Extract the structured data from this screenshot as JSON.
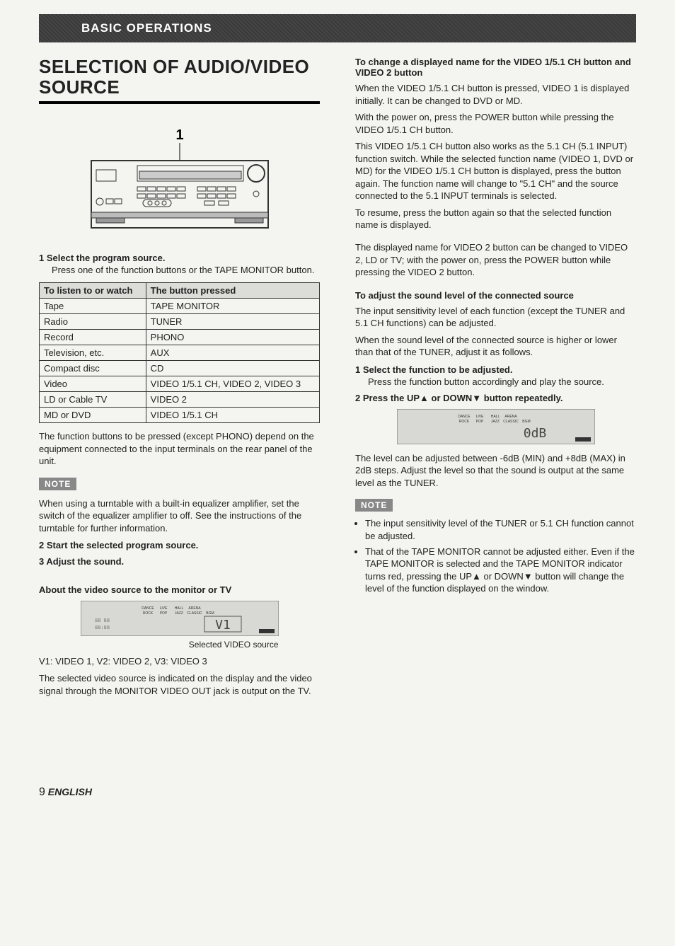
{
  "banner": "BASIC OPERATIONS",
  "title": "SELECTION OF AUDIO/VIDEO SOURCE",
  "diagram_label": "1",
  "left": {
    "step1_label": "1  Select the program source.",
    "step1_body": "Press one of the function buttons or the TAPE MONITOR button.",
    "table": {
      "headers": [
        "To listen to or watch",
        "The button pressed"
      ],
      "rows": [
        [
          "Tape",
          "TAPE MONITOR"
        ],
        [
          "Radio",
          "TUNER"
        ],
        [
          "Record",
          "PHONO"
        ],
        [
          "Television, etc.",
          "AUX"
        ],
        [
          "Compact disc",
          "CD"
        ],
        [
          "Video",
          "VIDEO 1/5.1 CH, VIDEO 2, VIDEO 3"
        ],
        [
          "LD or Cable TV",
          "VIDEO 2"
        ],
        [
          "MD or DVD",
          "VIDEO 1/5.1 CH"
        ]
      ]
    },
    "after_table": "The function buttons to be pressed (except PHONO) depend on the equipment connected to the input terminals on the rear panel of the unit.",
    "note_label": "NOTE",
    "note1_text": "When using a turntable with a built-in equalizer amplifier, set the switch of the equalizer amplifier to off. See the instructions of the turntable for further information.",
    "step2_label": "2  Start the selected program source.",
    "step3_label": "3  Adjust the sound.",
    "about_head": "About the video source to the monitor or TV",
    "display_labels": [
      "DANCE",
      "LIVE",
      "HALL",
      "ARENA",
      "",
      "ROCK",
      "POP",
      "JAZZ",
      "CLASSIC",
      "BGM"
    ],
    "display_value": "V1",
    "display_caption": "Selected VIDEO source",
    "video_legend": "V1: VIDEO 1, V2: VIDEO 2, V3: VIDEO 3",
    "video_para": "The selected video source is indicated on the display and the video signal through the MONITOR VIDEO OUT jack is output on the TV."
  },
  "right": {
    "head1": "To change a displayed name for the VIDEO 1/5.1 CH button and VIDEO 2 button",
    "p1": "When the VIDEO 1/5.1 CH button is pressed, VIDEO 1 is displayed initially. It can be changed to DVD or MD.",
    "p2": "With the power on, press the POWER button while pressing the VIDEO 1/5.1 CH button.",
    "p3": "This VIDEO 1/5.1 CH button also works as the 5.1 CH (5.1 INPUT) function switch. While the selected function name (VIDEO 1, DVD or MD) for the VIDEO 1/5.1 CH button is displayed, press the button again. The function name will change to \"5.1 CH\" and the source connected to the 5.1 INPUT terminals is selected.",
    "p4": "To resume, press the button again so that the selected function name is displayed.",
    "p5": "The displayed name for VIDEO 2 button can be changed to VIDEO 2, LD or TV; with the power on, press the POWER button while pressing the VIDEO 2 button.",
    "head2": "To adjust the sound level of the connected source",
    "p6": "The input sensitivity level of each function (except the TUNER and 5.1 CH functions) can be adjusted.",
    "p7": "When the sound level of the connected source is higher or lower than that of the TUNER, adjust it as follows.",
    "step1_label": "1  Select the function to be adjusted.",
    "step1_body": "Press the function button accordingly and play the source.",
    "step2_label": "2  Press the UP▲ or DOWN▼ button repeatedly.",
    "display_labels": [
      "DANCE",
      "LIVE",
      "HALL",
      "ARENA",
      "",
      "ROCK",
      "POP",
      "JAZZ",
      "CLASSIC",
      "BGM"
    ],
    "display_value": "0dB",
    "p8": "The level can be adjusted between -6dB (MIN) and +8dB (MAX) in 2dB steps. Adjust the level so that the sound is output at the same level as the TUNER.",
    "note_label": "NOTE",
    "note_items": [
      "The input sensitivity level of the TUNER or 5.1 CH function cannot be adjusted.",
      "That of the TAPE MONITOR cannot be adjusted either. Even if the TAPE MONITOR is selected and the TAPE MONITOR indicator turns red, pressing the UP▲ or DOWN▼ button will change the level of the function displayed on the window."
    ]
  },
  "footer": {
    "page": "9",
    "lang": "ENGLISH"
  }
}
